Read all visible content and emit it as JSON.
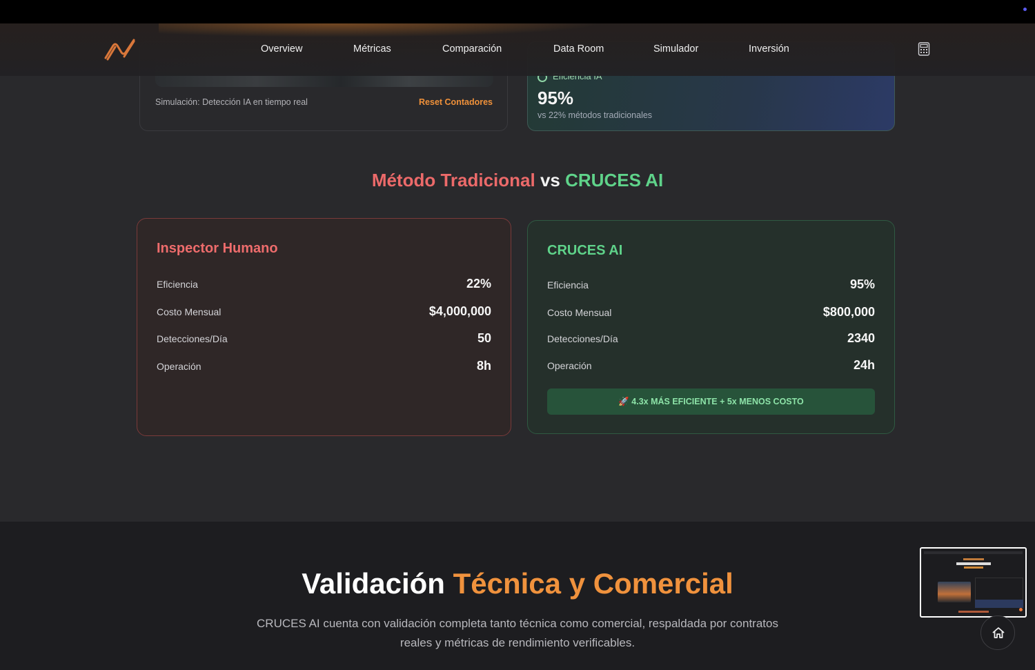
{
  "nav": {
    "links": [
      "Overview",
      "Métricas",
      "Comparación",
      "Data Room",
      "Simulador",
      "Inversión"
    ],
    "logo_icon": "wave-logo-icon",
    "calculator_icon": "calculator-icon"
  },
  "simulation": {
    "caption": "Simulación: Detección IA en tiempo real",
    "reset_label": "Reset Contadores"
  },
  "ai_efficiency": {
    "label": "Eficiencia IA",
    "value": "95%",
    "sub": "vs 22% métodos tradicionales"
  },
  "comparison": {
    "title_traditional": "Método Tradicional",
    "title_vs": "vs",
    "title_ai": "CRUCES AI",
    "human": {
      "title": "Inspector Humano",
      "rows": [
        {
          "label": "Eficiencia",
          "value": "22%"
        },
        {
          "label": "Costo Mensual",
          "value": "$4,000,000"
        },
        {
          "label": "Detecciones/Día",
          "value": "50"
        },
        {
          "label": "Operación",
          "value": "8h"
        }
      ]
    },
    "ai": {
      "title": "CRUCES AI",
      "rows": [
        {
          "label": "Eficiencia",
          "value": "95%"
        },
        {
          "label": "Costo Mensual",
          "value": "$800,000"
        },
        {
          "label": "Detecciones/Día",
          "value": "2340"
        },
        {
          "label": "Operación",
          "value": "24h"
        }
      ],
      "banner": "🚀 4.3x MÁS EFICIENTE + 5x MENOS COSTO"
    }
  },
  "validation": {
    "title_white": "Validación",
    "title_orange": "Técnica y Comercial",
    "description": "CRUCES AI cuenta con validación completa tanto técnica como comercial, respaldada por contratos reales y métricas de rendimiento verificables."
  },
  "colors": {
    "accent_orange": "#f0923d",
    "human_red": "#ee6c6c",
    "ai_green": "#5fd38a"
  }
}
